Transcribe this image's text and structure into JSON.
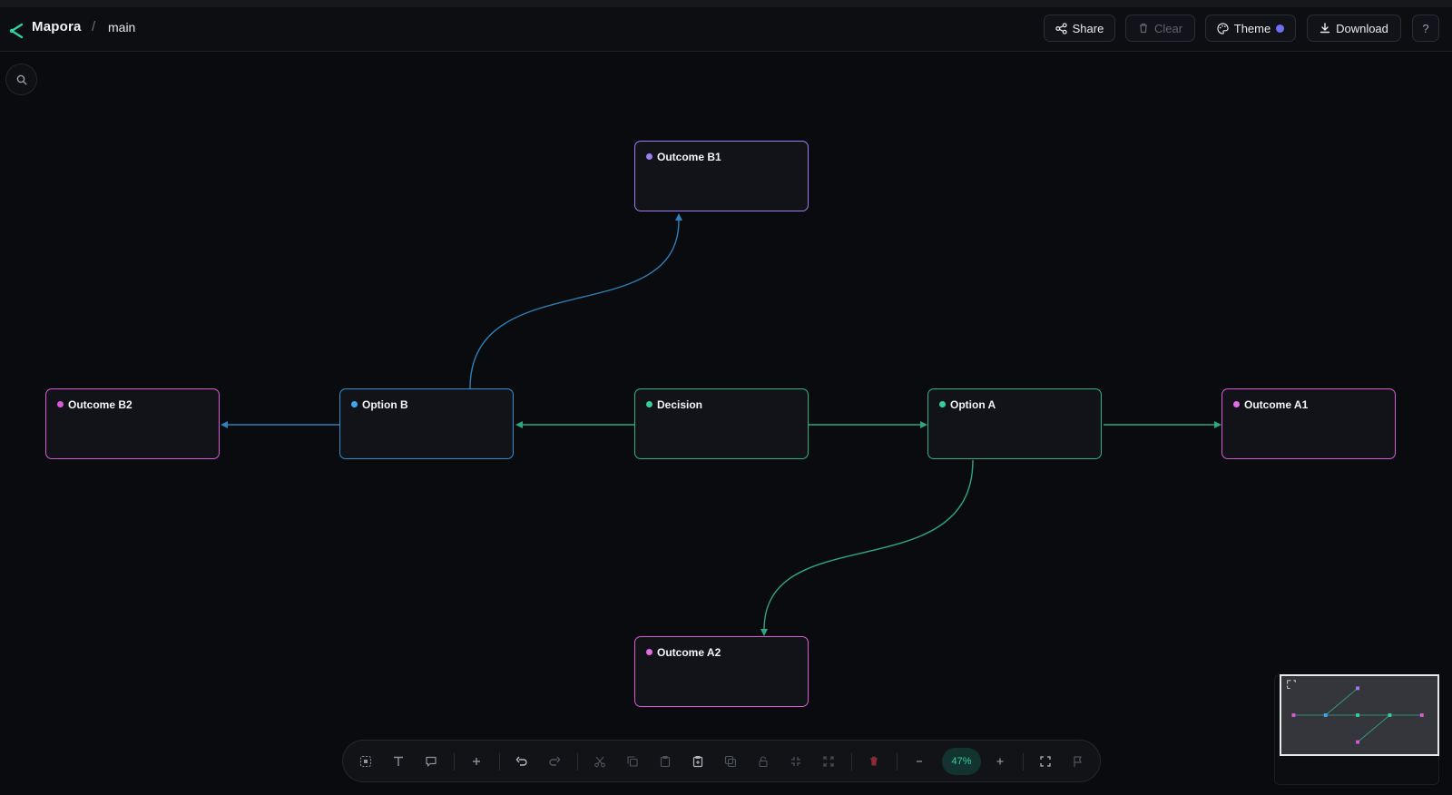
{
  "app": {
    "name": "Mapora",
    "breadcrumb": "main"
  },
  "header_buttons": {
    "share": "Share",
    "clear": "Clear",
    "theme": "Theme",
    "download": "Download",
    "help": "?"
  },
  "nodes": {
    "outcome_b1": {
      "label": "Outcome B1",
      "color": "#9f7df0"
    },
    "outcome_b2": {
      "label": "Outcome B2",
      "color": "#d85ad9"
    },
    "option_b": {
      "label": "Option B",
      "color": "#2f8fd0"
    },
    "decision": {
      "label": "Decision",
      "color": "#2fb386"
    },
    "option_a": {
      "label": "Option A",
      "color": "#2fb386"
    },
    "outcome_a1": {
      "label": "Outcome A1",
      "color": "#d85ad9"
    },
    "outcome_a2": {
      "label": "Outcome A2",
      "color": "#d85ad9"
    }
  },
  "edges": [
    {
      "from": "Decision",
      "to": "Option B",
      "color": "#2fa67e"
    },
    {
      "from": "Decision",
      "to": "Option A",
      "color": "#2fa67e"
    },
    {
      "from": "Option B",
      "to": "Outcome B2",
      "color": "#2f7fb8"
    },
    {
      "from": "Option B",
      "to": "Outcome B1",
      "color": "#2f7fb8"
    },
    {
      "from": "Option A",
      "to": "Outcome A1",
      "color": "#2fa67e"
    },
    {
      "from": "Option A",
      "to": "Outcome A2",
      "color": "#2fa67e"
    }
  ],
  "toolbar": {
    "zoom": "47%",
    "icons": [
      "select-icon",
      "text-icon",
      "comment-icon",
      "add-icon",
      "undo-icon",
      "redo-icon",
      "cut-icon",
      "copy-icon",
      "paste-icon",
      "clipboard-icon",
      "duplicate-icon",
      "lock-icon",
      "collapse-icon",
      "expand-icon",
      "delete-icon",
      "zoom-out-icon",
      "zoom-in-icon",
      "fit-view-icon",
      "flag-icon"
    ]
  },
  "colors": {
    "accent": "#2fd3a8",
    "background": "#0a0b0e",
    "delete": "#c0394b"
  }
}
